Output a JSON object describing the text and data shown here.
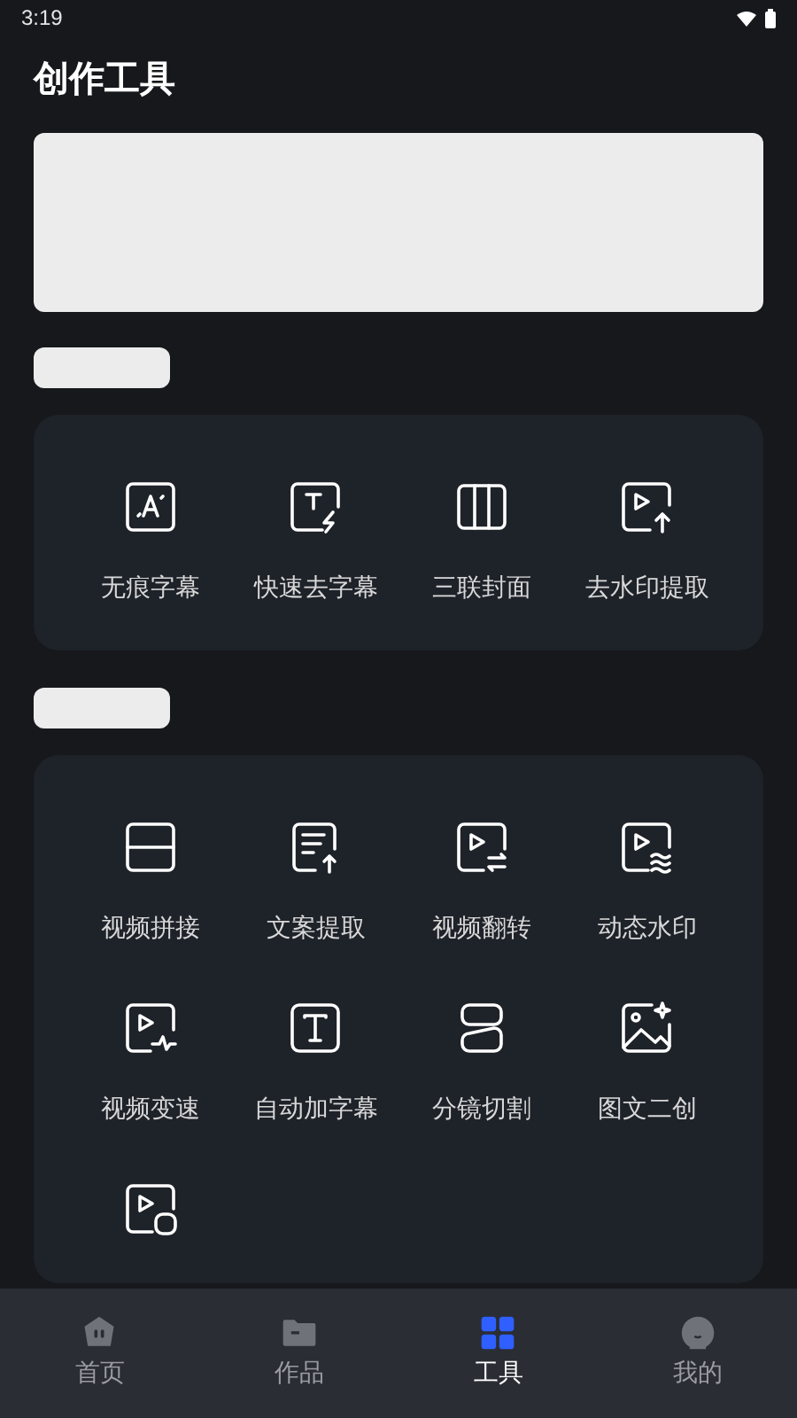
{
  "status_bar": {
    "time": "3:19"
  },
  "title": "创作工具",
  "sections": [
    {
      "tools": [
        {
          "kind": "text-a",
          "label": "无痕字幕"
        },
        {
          "kind": "text-bolt",
          "label": "快速去字幕"
        },
        {
          "kind": "columns",
          "label": "三联封面"
        },
        {
          "kind": "play-up",
          "label": "去水印提取"
        }
      ]
    },
    {
      "tools": [
        {
          "kind": "split-h",
          "label": "视频拼接"
        },
        {
          "kind": "doc-up",
          "label": "文案提取"
        },
        {
          "kind": "play-swap",
          "label": "视频翻转"
        },
        {
          "kind": "play-wave",
          "label": "动态水印"
        },
        {
          "kind": "play-pulse",
          "label": "视频变速"
        },
        {
          "kind": "t-box",
          "label": "自动加字幕"
        },
        {
          "kind": "two-boxes",
          "label": "分镜切割"
        },
        {
          "kind": "image-spark",
          "label": "图文二创"
        },
        {
          "kind": "play-square"
        }
      ]
    }
  ],
  "nav": [
    {
      "kind": "home",
      "label": "首页",
      "selected": false
    },
    {
      "kind": "folder",
      "label": "作品",
      "selected": false
    },
    {
      "kind": "grid",
      "label": "工具",
      "selected": true
    },
    {
      "kind": "face",
      "label": "我的",
      "selected": false
    }
  ]
}
